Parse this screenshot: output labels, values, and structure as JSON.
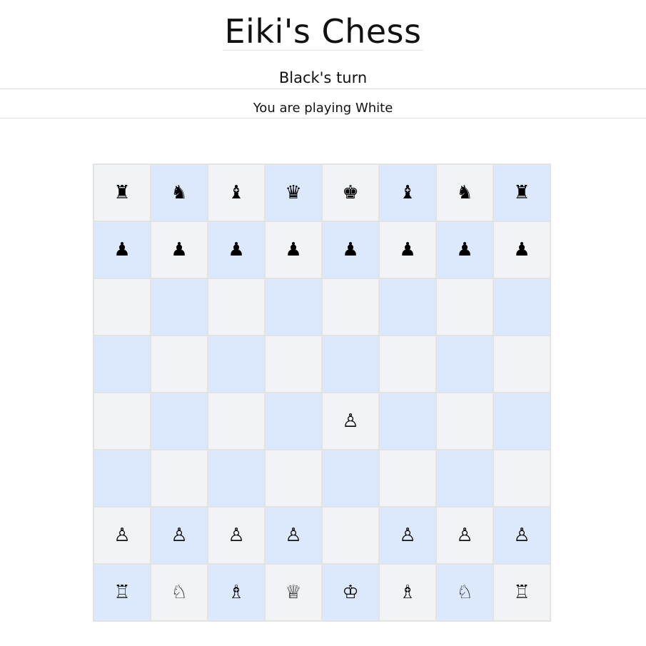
{
  "header": {
    "title": "Eiki's Chess",
    "turn": "Black's turn",
    "playing_as": "You are playing White"
  },
  "board": {
    "light_color": "#f2f3f5",
    "dark_color": "#dce9fd",
    "ranks": [
      [
        "♜",
        "♞",
        "♝",
        "♛",
        "♚",
        "♝",
        "♞",
        "♜"
      ],
      [
        "♟",
        "♟",
        "♟",
        "♟",
        "♟",
        "♟",
        "♟",
        "♟"
      ],
      [
        "",
        "",
        "",
        "",
        "",
        "",
        "",
        ""
      ],
      [
        "",
        "",
        "",
        "",
        "",
        "",
        "",
        ""
      ],
      [
        "",
        "",
        "",
        "",
        "♙",
        "",
        "",
        ""
      ],
      [
        "",
        "",
        "",
        "",
        "",
        "",
        "",
        ""
      ],
      [
        "♙",
        "♙",
        "♙",
        "♙",
        "",
        "♙",
        "♙",
        "♙"
      ],
      [
        "♖",
        "♘",
        "♗",
        "♕",
        "♔",
        "♗",
        "♘",
        "♖"
      ]
    ],
    "piece_names": {
      "♜": "black-rook-icon",
      "♞": "black-knight-icon",
      "♝": "black-bishop-icon",
      "♛": "black-queen-icon",
      "♚": "black-king-icon",
      "♟": "black-pawn-icon",
      "♖": "white-rook-icon",
      "♘": "white-knight-icon",
      "♗": "white-bishop-icon",
      "♕": "white-queen-icon",
      "♔": "white-king-icon",
      "♙": "white-pawn-icon"
    }
  }
}
